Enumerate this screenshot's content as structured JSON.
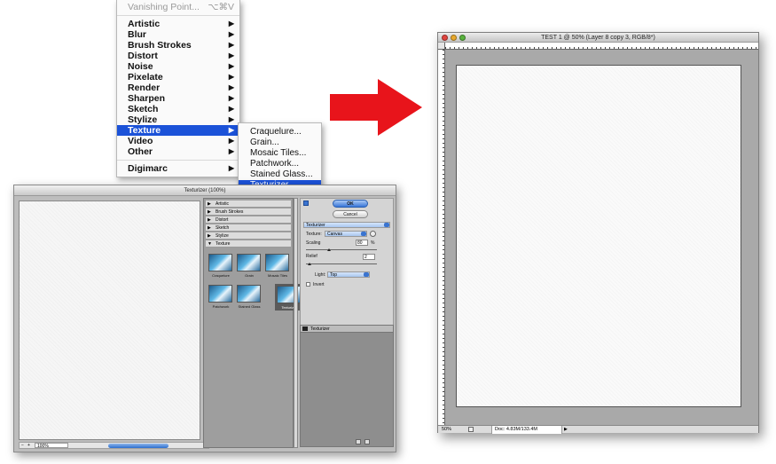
{
  "filter_menu": {
    "vanishing_point": "Vanishing Point...",
    "vanishing_point_shortcut": "⌥⌘V",
    "items": [
      "Artistic",
      "Blur",
      "Brush Strokes",
      "Distort",
      "Noise",
      "Pixelate",
      "Render",
      "Sharpen",
      "Sketch",
      "Stylize",
      "Texture",
      "Video",
      "Other"
    ],
    "digimarc": "Digimarc",
    "selected": "Texture",
    "submenu_arrow": "▶"
  },
  "texture_submenu": {
    "items": [
      "Craquelure...",
      "Grain...",
      "Mosaic Tiles...",
      "Patchwork...",
      "Stained Glass...",
      "Texturizer..."
    ],
    "selected": "Texturizer..."
  },
  "gallery": {
    "title": "Texturizer (100%)",
    "zoom": "100%",
    "categories": [
      "Artistic",
      "Brush Strokes",
      "Distort",
      "Sketch",
      "Stylize",
      "Texture"
    ],
    "expanded": "Texture",
    "thumbnails": [
      "Craquelure",
      "Grain",
      "Mosaic Tiles",
      "Patchwork",
      "Stained Glass",
      "Texturizer"
    ],
    "ok_label": "OK",
    "cancel_label": "Cancel",
    "filter_select": "Texturizer",
    "texture_label": "Texture:",
    "texture_value": "Canvas",
    "scaling_label": "Scaling",
    "scaling_value": "80",
    "scaling_unit": "%",
    "relief_label": "Relief",
    "relief_value": "2",
    "light_label": "Light:",
    "light_value": "Top",
    "invert_label": "Invert",
    "layer_name": "Texturizer",
    "expanded_triangle": "▼",
    "collapsed_triangle": "▶"
  },
  "arrow_color": "#e8141b",
  "document": {
    "title": "TEST 1 @ 50% (Layer 8 copy 3, RGB/8*)",
    "zoom": "50%",
    "doc_info": "Doc: 4.83M/133.4M",
    "nav_arrow": "▶"
  },
  "colors": {
    "menu_highlight": "#1b52d8",
    "traffic_close": "#e0443e",
    "traffic_min": "#e9a92d",
    "traffic_max": "#59b23e"
  }
}
